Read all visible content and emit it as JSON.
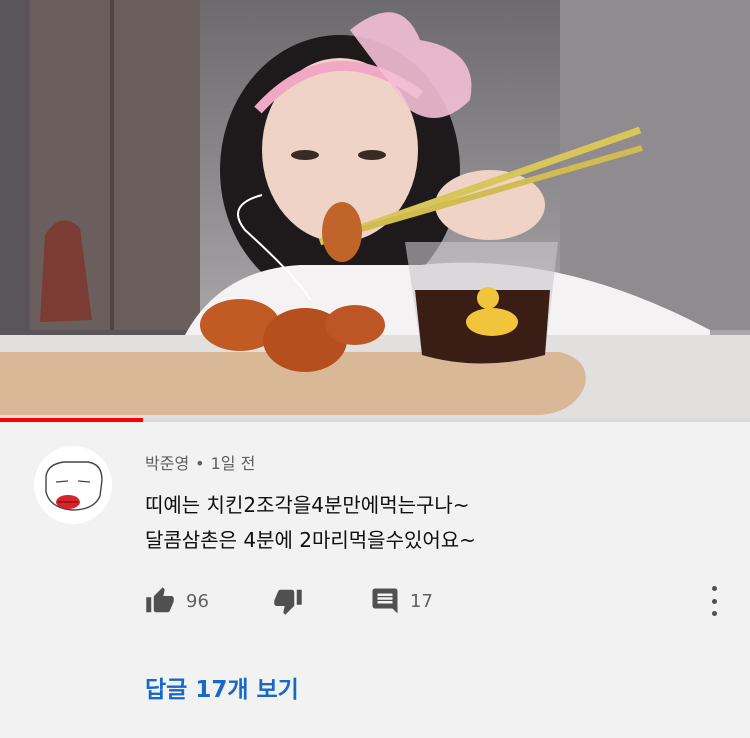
{
  "video": {
    "progress_fraction": 0.19
  },
  "comment": {
    "author": "박준영",
    "separator": "•",
    "time_ago": "1일 전",
    "lines": [
      "띠예는 치킨2조각을4분만에먹는구나~",
      "달콤삼촌은 4분에 2마리먹을수있어요~"
    ]
  },
  "actions": {
    "like_icon": "thumb-up-icon",
    "like_count": "96",
    "dislike_icon": "thumb-down-icon",
    "reply_icon": "reply-comment-icon",
    "reply_count": "17",
    "more_icon": "more-vertical-icon"
  },
  "replies": {
    "view_label": "답글 17개 보기"
  },
  "colors": {
    "progress": "#ff0000",
    "link": "#1868c8",
    "background": "#f2f2f2"
  }
}
